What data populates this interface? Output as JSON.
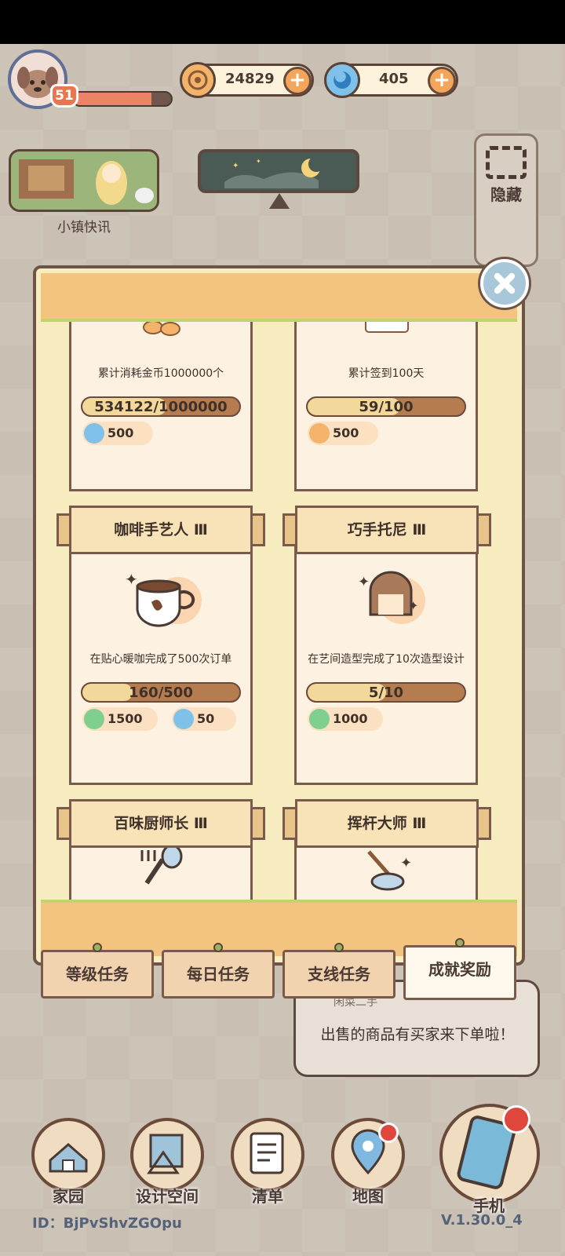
{
  "hud": {
    "level": "51",
    "coins": "24829",
    "gems": "405",
    "news_label": "小镇快讯",
    "hide_label": "隐藏"
  },
  "achievements": [
    {
      "title": "",
      "desc": "累计消耗金币1000000个",
      "progress_text": "534122/1000000",
      "progress": 0.534,
      "rewards": [
        {
          "icon": "gem-icon",
          "value": "500"
        }
      ]
    },
    {
      "title": "",
      "desc": "累计签到100天",
      "progress_text": "59/100",
      "progress": 0.59,
      "rewards": [
        {
          "icon": "coin-icon",
          "value": "500"
        }
      ]
    },
    {
      "title": "咖啡手艺人 Ⅲ",
      "desc": "在贴心暖咖完成了500次订单",
      "progress_text": "160/500",
      "progress": 0.32,
      "rewards": [
        {
          "icon": "clover-icon",
          "value": "1500"
        },
        {
          "icon": "gem-icon",
          "value": "50"
        }
      ]
    },
    {
      "title": "巧手托尼 Ⅲ",
      "desc": "在艺间造型完成了10次造型设计",
      "progress_text": "5/10",
      "progress": 0.5,
      "rewards": [
        {
          "icon": "clover-icon",
          "value": "1000"
        }
      ]
    },
    {
      "title": "百味厨师长 Ⅲ"
    },
    {
      "title": "挥杆大师 Ⅲ"
    }
  ],
  "tabs": [
    "等级任务",
    "每日任务",
    "支线任务",
    "成就奖励"
  ],
  "notification": {
    "source": "闲菜二手",
    "message": "出售的商品有买家来下单啦！"
  },
  "nav": [
    "家园",
    "设计空间",
    "清单",
    "地图",
    "手机"
  ],
  "footer": {
    "id": "ID：BjPvShvZGOpu",
    "version": "V.1.30.0_4"
  },
  "colors": {
    "panel_bg": "#f7ecbf",
    "header": "#f2c47f",
    "progress_fill": "#f2d89a",
    "progress_track": "#b57c4f",
    "accent_orange": "#f4a55c",
    "notify_red": "#e0473c"
  }
}
